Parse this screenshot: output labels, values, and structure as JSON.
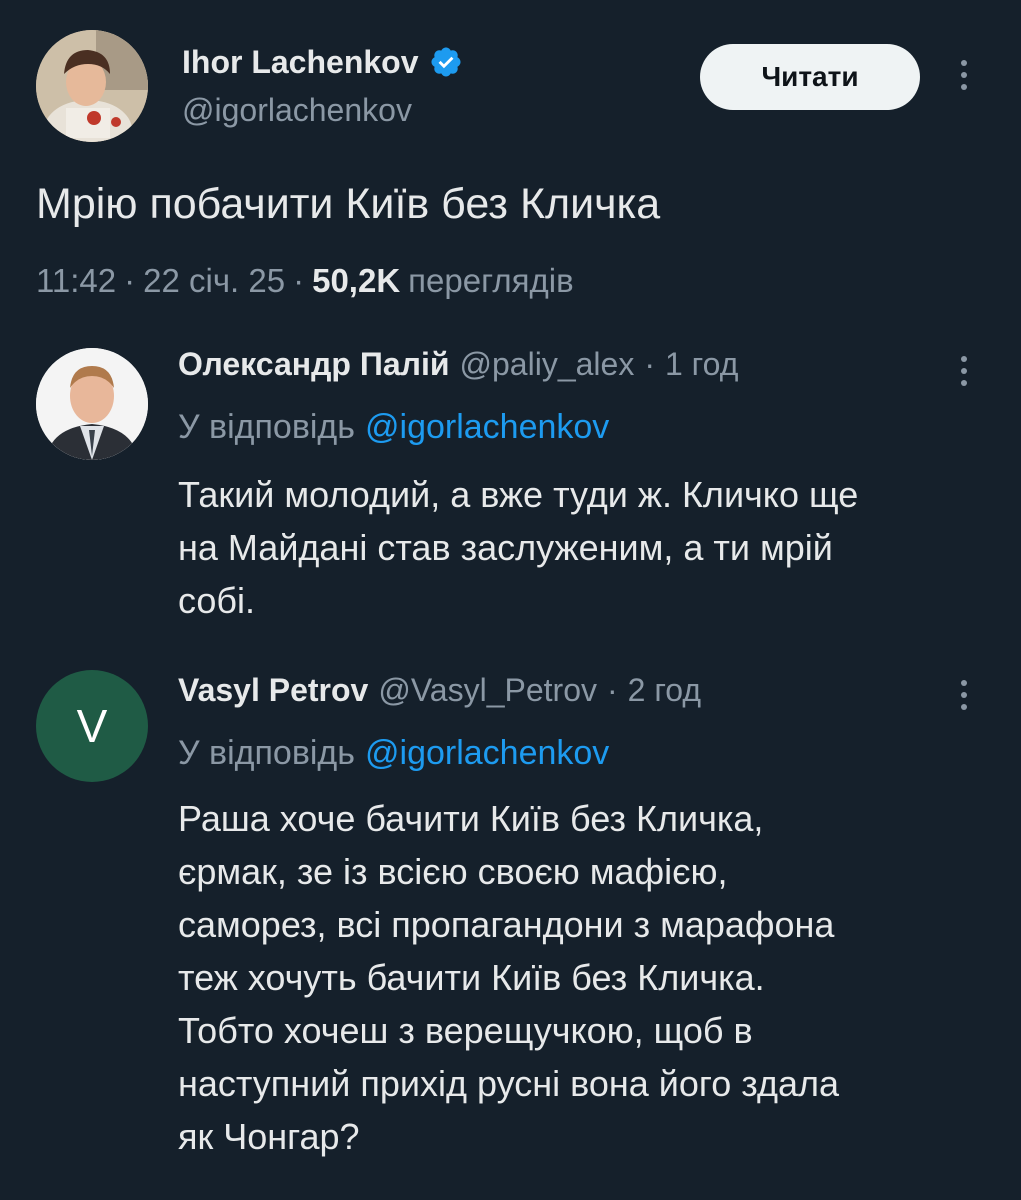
{
  "main_tweet": {
    "author_name": "Ihor Lachenkov",
    "author_handle": "@igorlachenkov",
    "follow_label": "Читати",
    "text": "Мрію побачити Київ без Кличка",
    "time": "11:42",
    "sep1": "·",
    "date": "22 січ. 25",
    "sep2": "·",
    "views_count": "50,2K",
    "views_label": "переглядів",
    "verified_icon": "verified-badge-icon",
    "accent_color": "#1d9bf0"
  },
  "replies": [
    {
      "author_name": "Олександр Палій",
      "author_handle": "@paliy_alex",
      "sep": "·",
      "time_ago": "1 год",
      "reply_to_label": "У відповідь",
      "reply_to_handle": "@igorlachenkov",
      "text": "Такий молодий, а вже туди ж. Кличко ще\nна Майдані став заслуженим, а ти мрій\nсобі."
    },
    {
      "author_name": "Vasyl Petrov",
      "author_handle": "@Vasyl_Petrov",
      "sep": "·",
      "time_ago": "2 год",
      "reply_to_label": "У відповідь",
      "reply_to_handle": "@igorlachenkov",
      "avatar_letter": "V",
      "avatar_color": "#1f5b45",
      "text": "Раша хоче бачити Київ без Кличка,\nєрмак, зе із всією своєю мафією,\nсаморез, всі пропагандони з марафона\nтеж хочуть бачити Київ без Кличка.\nТобто хочеш з верещучкою, щоб в\nнаступний прихід русні вона його здала\nяк Чонгар?"
    }
  ]
}
